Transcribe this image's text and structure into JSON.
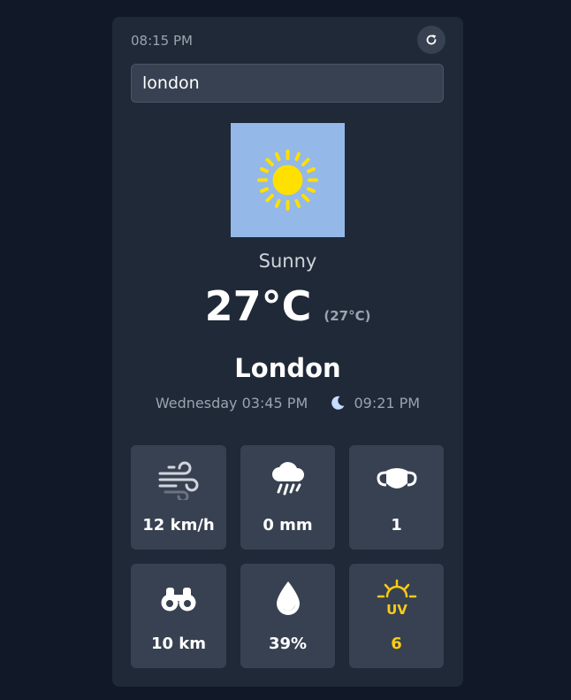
{
  "header": {
    "time": "08:15 PM",
    "refresh_icon": "refresh-icon"
  },
  "search": {
    "value": "london"
  },
  "current": {
    "condition": "Sunny",
    "temperature": "27°C",
    "feels_like": "(27°C)",
    "city": "London",
    "local_time": "Wednesday 03:45 PM",
    "moon_time": "09:21 PM",
    "image_icon": "sun-icon"
  },
  "tiles": [
    {
      "icon": "wind-icon",
      "value": "12 km/h"
    },
    {
      "icon": "rain-icon",
      "value": "0 mm"
    },
    {
      "icon": "mask-icon",
      "value": "1"
    },
    {
      "icon": "binoculars-icon",
      "value": "10 km"
    },
    {
      "icon": "droplet-icon",
      "value": "39%"
    },
    {
      "icon": "uv-icon",
      "value": "6"
    }
  ],
  "colors": {
    "background": "#111827",
    "card": "#1f2937",
    "tile": "#374151",
    "uv_accent": "#facc15",
    "sun": "#ffe000",
    "sky": "#94b8e8"
  }
}
